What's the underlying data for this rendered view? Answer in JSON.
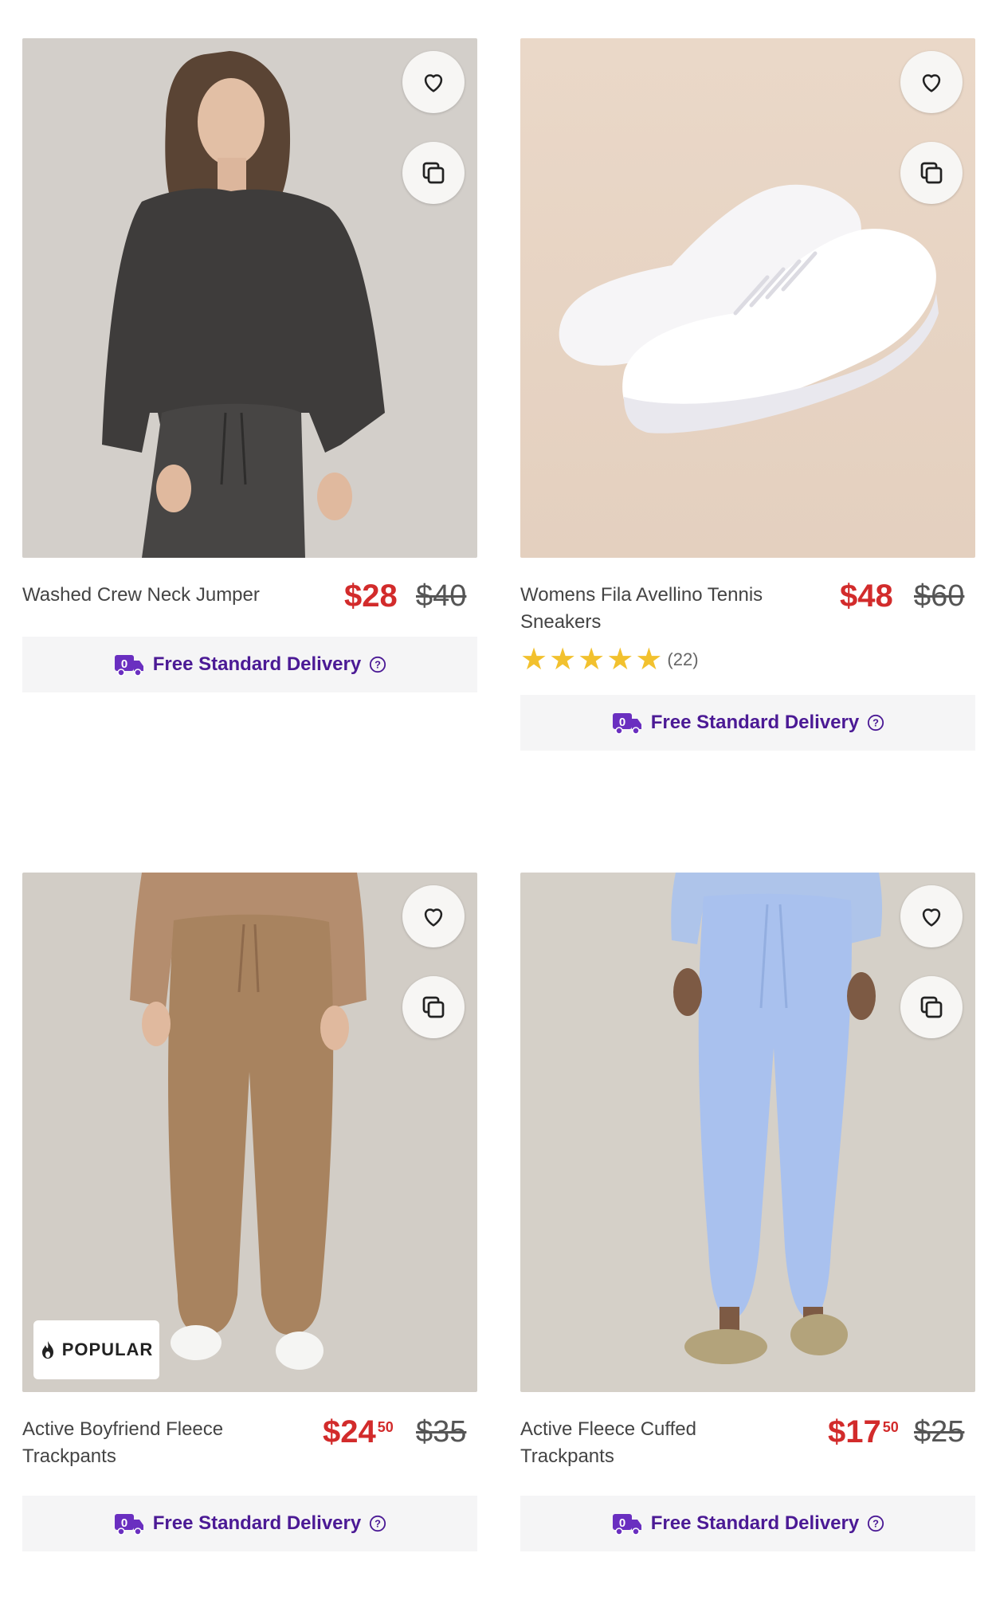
{
  "products": [
    {
      "title": "Washed Crew Neck Jumper",
      "price_now": "$28",
      "price_now_cents": "",
      "price_was": "$40",
      "delivery": "Free Standard Delivery",
      "favorite_icon": "heart-outline-icon",
      "compare_icon": "copy-icon"
    },
    {
      "title": "Womens Fila Avellino Tennis Sneakers",
      "price_now": "$48",
      "price_now_cents": "",
      "price_was": "$60",
      "rating": 5,
      "rating_count": "(22)",
      "delivery": "Free Standard Delivery",
      "favorite_icon": "heart-outline-icon",
      "compare_icon": "copy-icon"
    },
    {
      "title": "Active Boyfriend Fleece Trackpants",
      "price_now": "$24",
      "price_now_cents": "50",
      "price_was": "$35",
      "badge": "POPULAR",
      "delivery": "Free Standard Delivery",
      "favorite_icon": "heart-outline-icon",
      "compare_icon": "copy-icon"
    },
    {
      "title": "Active Fleece Cuffed Trackpants",
      "price_now": "$17",
      "price_now_cents": "50",
      "price_was": "$25",
      "delivery": "Free Standard Delivery",
      "favorite_icon": "heart-outline-icon",
      "compare_icon": "copy-icon"
    }
  ],
  "colors": {
    "sale_price": "#d22b2b",
    "delivery_text": "#4b1a95",
    "rating_star": "#f2c12e"
  }
}
